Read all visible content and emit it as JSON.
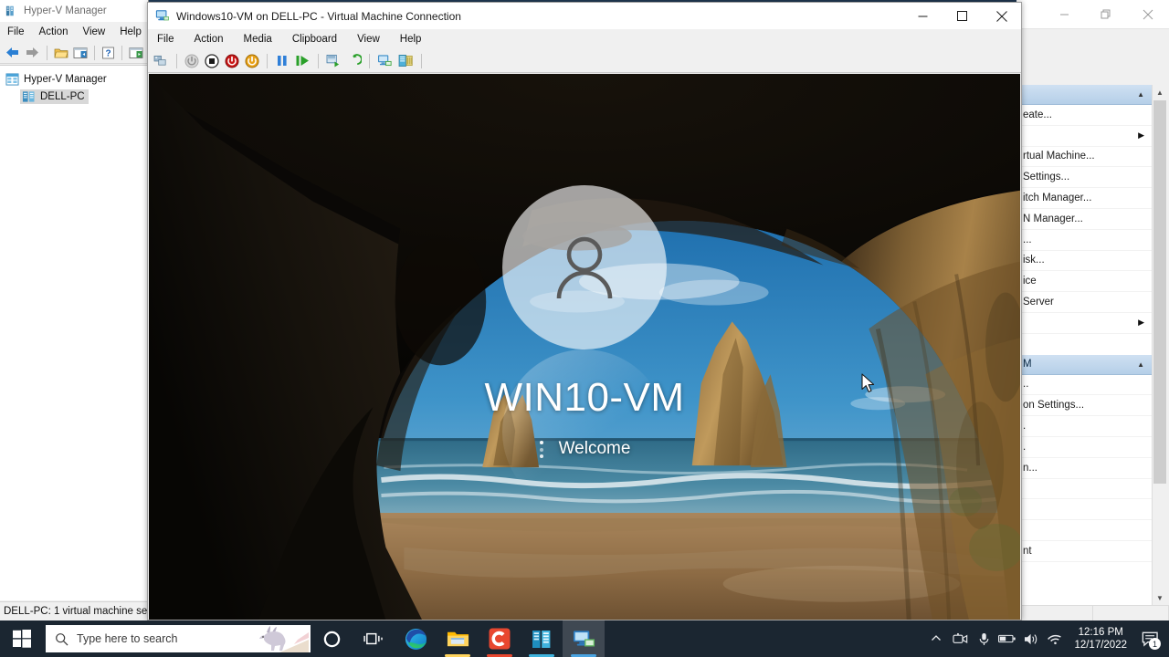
{
  "hyperv_manager": {
    "title": "Hyper-V Manager",
    "menu": [
      "File",
      "Action",
      "View",
      "Help"
    ],
    "toolbar_icons": [
      "back-arrow-icon",
      "forward-arrow-icon",
      "open-folder-icon",
      "show-pane-icon",
      "help-icon",
      "show-actions-pane-icon"
    ],
    "tree": [
      {
        "label": "Hyper-V Manager",
        "icon": "hyperv-root-icon"
      },
      {
        "label": "DELL-PC",
        "icon": "server-icon",
        "selected": true
      }
    ],
    "status": "DELL-PC:  1 virtual machine sele"
  },
  "background_window": {
    "window_controls": [
      "minimize-icon",
      "restore-icon",
      "close-icon"
    ],
    "actions": {
      "header": "",
      "items": [
        {
          "label": "eate...",
          "submenu": false
        },
        {
          "label": "",
          "submenu": true
        },
        {
          "label": "rtual Machine...",
          "submenu": false
        },
        {
          "label": "Settings...",
          "submenu": false
        },
        {
          "label": "itch Manager...",
          "submenu": false
        },
        {
          "label": "N Manager...",
          "submenu": false
        },
        {
          "label": "...",
          "submenu": false
        },
        {
          "label": "isk...",
          "submenu": false
        },
        {
          "label": "ice",
          "submenu": false
        },
        {
          "label": "Server",
          "submenu": false
        },
        {
          "label": "",
          "submenu": true
        },
        {
          "label": "",
          "submenu": false
        }
      ],
      "second_header": "M",
      "second_items": [
        {
          "label": "..",
          "submenu": false
        },
        {
          "label": "on Settings...",
          "submenu": false
        },
        {
          "label": ".",
          "submenu": false
        },
        {
          "label": ".",
          "submenu": false
        },
        {
          "label": "n...",
          "submenu": false
        },
        {
          "label": "",
          "submenu": false
        },
        {
          "label": "",
          "submenu": false
        },
        {
          "label": "",
          "submenu": false
        },
        {
          "label": "nt",
          "submenu": false
        }
      ]
    }
  },
  "vmconnect": {
    "title": "Windows10-VM on DELL-PC - Virtual Machine Connection",
    "title_icon": "vmconnect-icon",
    "menu": [
      "File",
      "Action",
      "Media",
      "Clipboard",
      "View",
      "Help"
    ],
    "window_controls": {
      "minimize": "minimize-icon",
      "maximize": "maximize-icon",
      "close": "close-icon"
    },
    "toolbar_icons": [
      "ctrl-alt-del-icon",
      "start-icon",
      "shut-down-icon",
      "turn-off-icon",
      "save-icon",
      "pause-icon",
      "resume-icon",
      "checkpoint-icon",
      "revert-icon",
      "enhanced-session-icon",
      "settings-icon"
    ]
  },
  "lock_screen": {
    "username": "WIN10-VM",
    "status": "Welcome",
    "avatar_icon": "user-avatar-icon",
    "wallpaper": "wharariki-beach-cave"
  },
  "taskbar": {
    "start_icon": "windows-start-icon",
    "search": {
      "placeholder": "Type here to search",
      "icon": "search-icon"
    },
    "items": [
      {
        "name": "cortana",
        "icon": "cortana-icon",
        "active": false,
        "running": false
      },
      {
        "name": "task-view",
        "icon": "task-view-icon",
        "active": false,
        "running": false
      },
      {
        "name": "microsoft-edge",
        "icon": "edge-icon",
        "active": false,
        "running": false
      },
      {
        "name": "file-explorer",
        "icon": "file-explorer-icon",
        "active": false,
        "running": true
      },
      {
        "name": "camtasia",
        "icon": "camtasia-icon",
        "active": false,
        "running": true
      },
      {
        "name": "hyper-v-manager",
        "icon": "hyperv-icon",
        "active": false,
        "running": true
      },
      {
        "name": "vm-connection",
        "icon": "vmconnect-icon",
        "active": true,
        "running": true
      }
    ],
    "tray": {
      "icons": [
        "show-hidden-icons-chevron",
        "camera-icon",
        "microphone-icon",
        "battery-icon",
        "volume-icon",
        "wifi-icon"
      ],
      "time": "12:16 PM",
      "date": "12/17/2022",
      "notifications_icon": "action-center-icon",
      "notifications_count": "1"
    }
  },
  "colors": {
    "taskbar": "#1b2631",
    "accent": "#4aa3e0",
    "window_chrome": "#f0f0f0",
    "selection": "#b5cfe8"
  }
}
